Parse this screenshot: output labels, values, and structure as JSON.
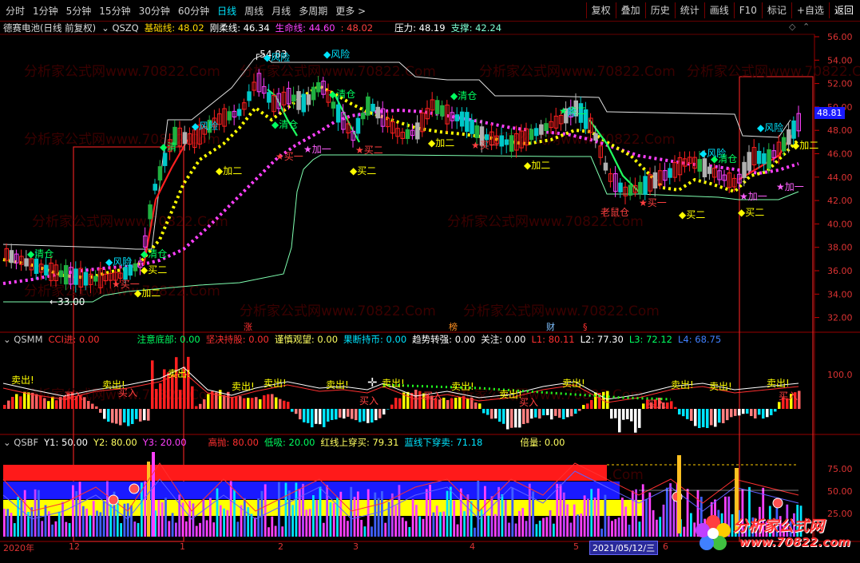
{
  "toolbar": {
    "periods": [
      "分时",
      "1分钟",
      "5分钟",
      "15分钟",
      "30分钟",
      "60分钟",
      "日线",
      "周线",
      "月线",
      "多周期",
      "更多 >"
    ],
    "active_period": "日线",
    "actions": [
      "复权",
      "叠加",
      "历史",
      "统计",
      "画线",
      "F10",
      "标记",
      "+自选",
      "返回"
    ]
  },
  "main_header": {
    "stock": "德赛电池(日线 前复权)",
    "indicator": "QSZQ",
    "jichu_label": "基础线:",
    "jichu_value": "48.02",
    "gangrou_label": "刚柔线:",
    "gangrou_value": "46.34",
    "shengming_label": "生命线:",
    "shengming_value": "44.60",
    "extra_value": "48.02",
    "yali_label": "压力:",
    "yali_value": "48.19",
    "zhicheng_label": "支撑:",
    "zhicheng_value": "42.24"
  },
  "price_axis": [
    "56.00",
    "54.00",
    "52.00",
    "50.00",
    "48.00",
    "46.00",
    "44.00",
    "42.00",
    "40.00",
    "38.00",
    "36.00",
    "34.00",
    "32.00"
  ],
  "current_price": "48.81",
  "main_annotations": [
    "54.83",
    "33.00",
    "风险",
    "风险",
    "风险",
    "风险",
    "风险",
    "风险",
    "清仓",
    "清仓",
    "清仓",
    "清仓",
    "清仓",
    "清仓",
    "清仓",
    "加二",
    "加二",
    "加二",
    "加一",
    "加一",
    "加一",
    "买二",
    "买二",
    "买二",
    "买二",
    "买二",
    "买一",
    "买一",
    "买一",
    "买一",
    "买一",
    "老鼠仓",
    "险",
    "卖二",
    "加二"
  ],
  "event_marks": [
    "涨",
    "榜",
    "财",
    "§"
  ],
  "qsmm_header": {
    "name": "QSMM",
    "cci_label": "CCI进:",
    "cci_value": "0.00",
    "zhuyi_label": "注意底部:",
    "zhuyi_value": "0.00",
    "jianjue_label": "坚决持股:",
    "jianjue_value": "0.00",
    "jinshen_label": "谨慎观望:",
    "jinshen_value": "0.00",
    "guoduan_label": "果断持币:",
    "guoduan_value": "0.00",
    "qushi_label": "趋势转强:",
    "qushi_value": "0.00",
    "guanzhu_label": "关注:",
    "guanzhu_value": "0.00",
    "l1": "L1: 80.11",
    "l2": "L2: 77.30",
    "l3": "L3: 72.12",
    "l4": "L4: 68.75"
  },
  "qsmm_axis": [
    "100.0"
  ],
  "qsmm_annotations": [
    "卖出!",
    "卖出!",
    "卖出!",
    "卖出!",
    "卖出!",
    "卖出!",
    "卖出!",
    "卖出!",
    "卖出!",
    "卖出!",
    "卖出!",
    "卖出!",
    "卖出!",
    "买入",
    "买入",
    "买入",
    "买入",
    "买入",
    "买入",
    "买入"
  ],
  "qsbf_header": {
    "name": "QSBF",
    "y1": "Y1: 50.00",
    "y2": "Y2: 80.00",
    "y3": "Y3: 20.00",
    "gaopao": "高抛: 80.00",
    "dixi": "低吸: 20.00",
    "hongxian": "红线上穿买: 79.31",
    "lanxian": "蓝线下穿卖: 71.18",
    "beiliang": "倍量: 0.00"
  },
  "qsbf_axis": [
    "75.00",
    "50.00",
    "25.00"
  ],
  "date_axis": [
    "2020年",
    "12",
    "1",
    "2",
    "3",
    "4",
    "5",
    "6"
  ],
  "date_box": "2021/05/12/三",
  "watermark": "分析家公式网www.70822.Com",
  "logo": {
    "cn": "分析家公式网",
    "en": "www.70822.com"
  },
  "colors": {
    "up": "#ff2020",
    "down": "#00c8c8",
    "magenta": "#ff40ff",
    "yellow": "#ffff00",
    "axis": "#c00000"
  }
}
